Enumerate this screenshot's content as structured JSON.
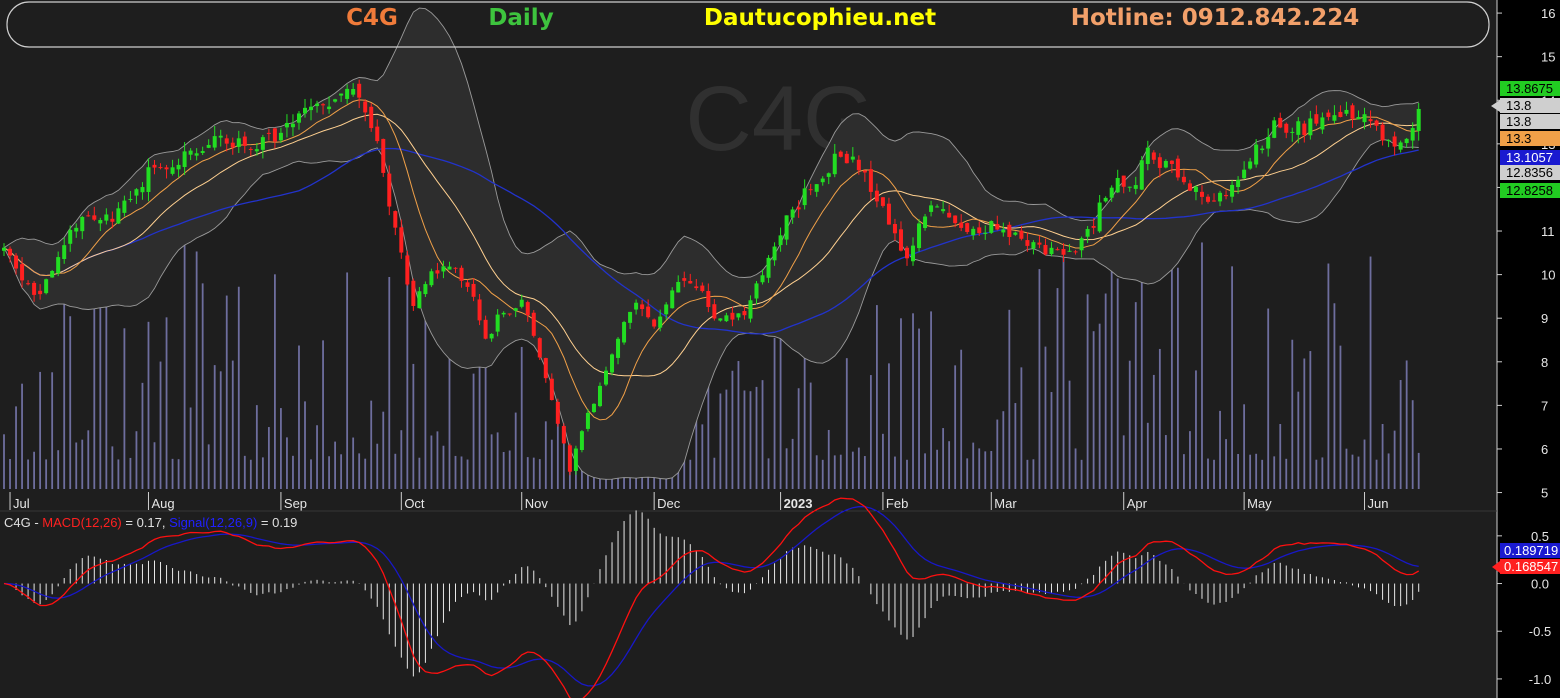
{
  "header": {
    "ticker": "C4G",
    "period": "Daily",
    "site": "Dautucophieu.net",
    "hotline": "Hotline: 0912.842.224",
    "watermark": "C4G",
    "colors": {
      "ticker": "#f07b3a",
      "period": "#3ec43e",
      "site": "#ffff00",
      "hotline": "#f2a06a"
    }
  },
  "chart_data": [
    {
      "type": "candlestick",
      "title": "",
      "symbol": "C4G",
      "ylim": [
        4.6,
        16.3
      ],
      "y_ticks": [
        5,
        6,
        7,
        8,
        9,
        10,
        11,
        12,
        13,
        14,
        15,
        16
      ],
      "x_month_labels": [
        {
          "label": "Jul",
          "index": 1
        },
        {
          "label": "Aug",
          "index": 24
        },
        {
          "label": "Sep",
          "index": 46
        },
        {
          "label": "Oct",
          "index": 66
        },
        {
          "label": "Nov",
          "index": 86
        },
        {
          "label": "Dec",
          "index": 108
        },
        {
          "label": "2023",
          "index": 129
        },
        {
          "label": "Feb",
          "index": 146
        },
        {
          "label": "Mar",
          "index": 164
        },
        {
          "label": "Apr",
          "index": 186
        },
        {
          "label": "May",
          "index": 206
        },
        {
          "label": "Jun",
          "index": 226
        }
      ],
      "bold_labels": [
        "2023"
      ],
      "close_anchors": [
        [
          0,
          10.5
        ],
        [
          5,
          9.5
        ],
        [
          8,
          10.0
        ],
        [
          12,
          11.2
        ],
        [
          18,
          11.3
        ],
        [
          24,
          12.3
        ],
        [
          30,
          12.7
        ],
        [
          36,
          13.2
        ],
        [
          42,
          12.9
        ],
        [
          48,
          13.5
        ],
        [
          54,
          14.0
        ],
        [
          58,
          14.2
        ],
        [
          60,
          13.9
        ],
        [
          62,
          13.0
        ],
        [
          64,
          11.5
        ],
        [
          66,
          10.5
        ],
        [
          68,
          9.3
        ],
        [
          70,
          9.9
        ],
        [
          74,
          10.2
        ],
        [
          78,
          9.5
        ],
        [
          80,
          8.5
        ],
        [
          82,
          9.0
        ],
        [
          86,
          9.4
        ],
        [
          88,
          8.5
        ],
        [
          91,
          7.2
        ],
        [
          94,
          5.5
        ],
        [
          96,
          6.4
        ],
        [
          99,
          7.5
        ],
        [
          102,
          8.6
        ],
        [
          105,
          9.3
        ],
        [
          108,
          8.9
        ],
        [
          111,
          9.6
        ],
        [
          114,
          9.9
        ],
        [
          118,
          9.1
        ],
        [
          121,
          8.9
        ],
        [
          124,
          9.3
        ],
        [
          127,
          10.5
        ],
        [
          130,
          11.3
        ],
        [
          134,
          12.0
        ],
        [
          138,
          12.6
        ],
        [
          141,
          12.8
        ],
        [
          143,
          12.2
        ],
        [
          145,
          11.8
        ],
        [
          148,
          10.8
        ],
        [
          150,
          10.5
        ],
        [
          153,
          11.4
        ],
        [
          156,
          11.6
        ],
        [
          160,
          10.9
        ],
        [
          164,
          11.1
        ],
        [
          168,
          10.9
        ],
        [
          172,
          10.6
        ],
        [
          176,
          10.4
        ],
        [
          180,
          10.9
        ],
        [
          182,
          11.5
        ],
        [
          185,
          12.2
        ],
        [
          188,
          12.1
        ],
        [
          190,
          12.8
        ],
        [
          193,
          12.5
        ],
        [
          196,
          12.1
        ],
        [
          199,
          11.8
        ],
        [
          202,
          11.8
        ],
        [
          205,
          12.3
        ],
        [
          208,
          12.9
        ],
        [
          211,
          13.4
        ],
        [
          214,
          13.3
        ],
        [
          217,
          13.4
        ],
        [
          220,
          13.5
        ],
        [
          223,
          13.6
        ],
        [
          226,
          13.5
        ],
        [
          229,
          13.2
        ],
        [
          231,
          12.9
        ],
        [
          233,
          13.2
        ],
        [
          235,
          13.9
        ]
      ],
      "last_close": 13.8,
      "ma_periods": [
        10,
        20,
        50
      ],
      "bollinger": {
        "period": 20,
        "k": 2
      },
      "series_colors": {
        "up": "#22dd22",
        "down": "#ff2020",
        "ma_fast": "#f0a048",
        "ma_mid": "#ffd090",
        "ma_slow": "#2233cc",
        "band": "#9a9a9a",
        "volume": "#6e6e9e"
      },
      "right_tags": [
        {
          "value": "13.8675",
          "bg": "#22cc22",
          "fg": "#000000"
        },
        {
          "value": "13.8",
          "bg": "#cfcfcf",
          "fg": "#000000"
        },
        {
          "value": "13.8",
          "bg": "#cfcfcf",
          "fg": "#000000"
        },
        {
          "value": "13.3",
          "bg": "#f0a048",
          "fg": "#000000"
        },
        {
          "value": "13.1057",
          "bg": "#1a1ad0",
          "fg": "#ffffff"
        },
        {
          "value": "12.8356",
          "bg": "#cfcfcf",
          "fg": "#000000"
        },
        {
          "value": "12.8258",
          "bg": "#22cc22",
          "fg": "#000000"
        }
      ]
    },
    {
      "type": "line",
      "title": "",
      "legend": {
        "prefix": "C4G - ",
        "macd_label": "MACD(12,26)",
        "macd_value": " = 0.17, ",
        "signal_label": "Signal(12,26,9)",
        "signal_value": " = 0.19"
      },
      "ylim": [
        -1.2,
        0.75
      ],
      "y_ticks": [
        {
          "v": 0.5,
          "t": "0.5"
        },
        {
          "v": 0.0,
          "t": "0.0"
        },
        {
          "v": -0.5,
          "t": "-0.5"
        },
        {
          "v": -1.0,
          "t": "-1.0"
        }
      ],
      "series_colors": {
        "macd": "#ff1010",
        "signal": "#1818c8",
        "histogram": "#e8e8e8"
      },
      "right_tags": [
        {
          "value": "0.189719",
          "bg": "#1a1ad0",
          "fg": "#ffffff"
        },
        {
          "value": "0.168547",
          "bg": "#ff2020",
          "fg": "#ffffff"
        }
      ]
    }
  ]
}
